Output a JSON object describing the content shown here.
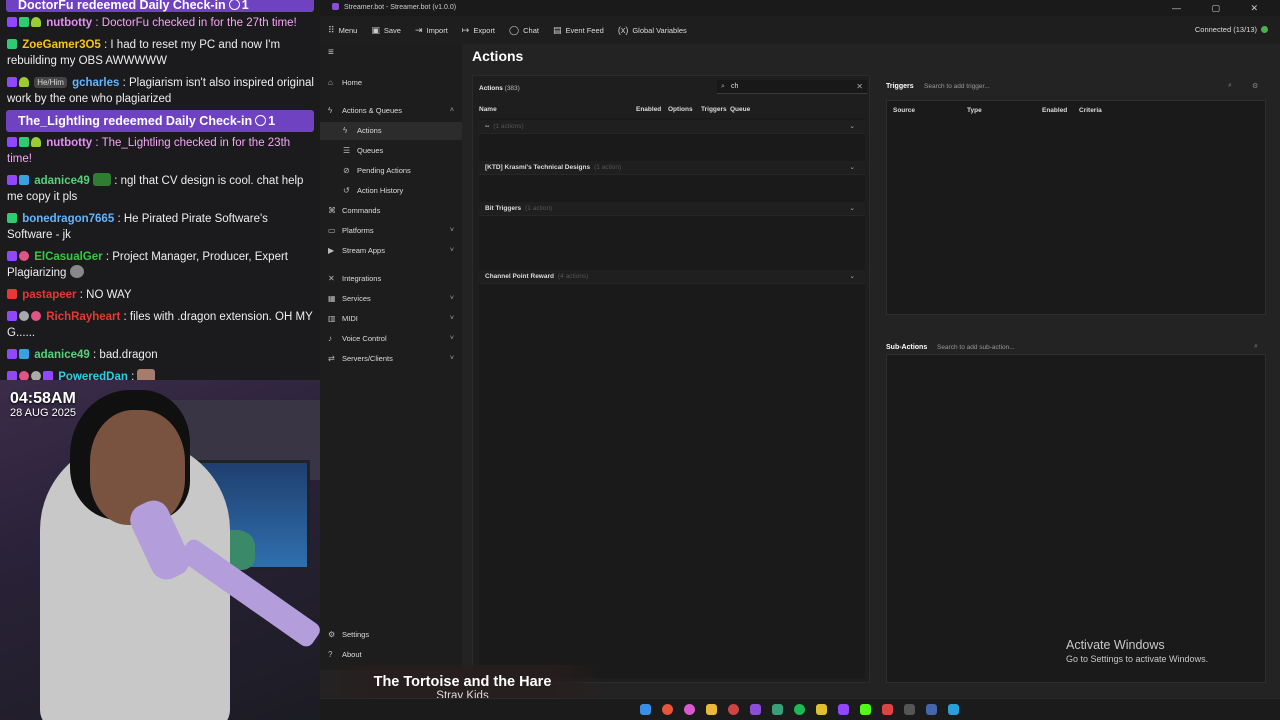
{
  "chat": {
    "redeems": [
      {
        "text": "DoctorFu redeemed Daily Check-in",
        "count": "1"
      },
      {
        "text": "The_Lightling redeemed Daily Check-in",
        "count": "1"
      }
    ],
    "messages": [
      {
        "user": "nutbotty",
        "color": "#e48df2",
        "text": ": DoctorFu checked in for the 27th time!",
        "text_color": "#f6a6f6"
      },
      {
        "user": "ZoeGamer3O5",
        "color": "#f5c518",
        "text": ": I had to reset my PC and now I'm rebuilding my OBS AWWWWW"
      },
      {
        "user": "gcharles",
        "pronoun": "He/Him",
        "color": "#62b6ff",
        "text": ": Plagiarism isn't also inspired original work by the one who plagiarized"
      },
      {
        "user": "nutbotty",
        "color": "#e48df2",
        "text": ": The_Lightling checked in for the 23th time!",
        "text_color": "#f6a6f6"
      },
      {
        "user": "adanice49",
        "color": "#5ad07a",
        "text": ": ngl that CV design is cool. chat help me copy it pls"
      },
      {
        "user": "bonedragon7665",
        "color": "#62b6ff",
        "text": ": He Pirated Pirate Software's Software - jk"
      },
      {
        "user": "ElCasualGer",
        "color": "#2ecc40",
        "text": ": Project Manager, Producer, Expert Plagiarizing"
      },
      {
        "user": "pastapeer",
        "color": "#e53935",
        "text": ": NO WAY"
      },
      {
        "user": "RichRayheart",
        "color": "#e53935",
        "text": ": files with .dragon extension. OH MY G......"
      },
      {
        "user": "adanice49",
        "color": "#5ad07a",
        "text": ": bad.dragon"
      },
      {
        "user": "PoweredDan",
        "color": "#2ecce0",
        "text": ":"
      }
    ]
  },
  "overlay": {
    "time": "04:58AM",
    "date": "28 AUG 2025",
    "song_title": "The Tortoise and the Hare",
    "song_artist": "Stray Kids"
  },
  "window": {
    "title": "Streamer.bot - Streamer.bot (v1.0.0)",
    "controls": "— ▢ ✕"
  },
  "toolbar": {
    "menu": "Menu",
    "save": "Save",
    "import": "Import",
    "export": "Export",
    "chat": "Chat",
    "event_feed": "Event Feed",
    "global_variables": "Global Variables",
    "connected": "Connected (13/13)"
  },
  "sidebar": {
    "items": [
      {
        "label": "Home",
        "icon": "home-icon"
      },
      {
        "label": "Actions & Queues",
        "icon": "bolt-icon",
        "chevron": "˄"
      },
      {
        "label": "Actions",
        "icon": "bolt-icon"
      },
      {
        "label": "Queues",
        "icon": "list-icon"
      },
      {
        "label": "Pending Actions",
        "icon": "pending-icon"
      },
      {
        "label": "Action History",
        "icon": "history-icon"
      },
      {
        "label": "Commands",
        "icon": "terminal-icon"
      },
      {
        "label": "Platforms",
        "icon": "platform-icon",
        "chevron": "˅"
      },
      {
        "label": "Stream Apps",
        "icon": "apps-icon",
        "chevron": "˅"
      },
      {
        "label": "Integrations",
        "icon": "integration-icon"
      },
      {
        "label": "Services",
        "icon": "grid-icon",
        "chevron": "˅"
      },
      {
        "label": "MIDI",
        "icon": "midi-icon",
        "chevron": "˅"
      },
      {
        "label": "Voice Control",
        "icon": "mic-icon",
        "chevron": "˅"
      },
      {
        "label": "Servers/Clients",
        "icon": "server-icon",
        "chevron": "˅"
      },
      {
        "label": "Settings",
        "icon": "gear-icon"
      },
      {
        "label": "About",
        "icon": "info-icon"
      }
    ]
  },
  "main": {
    "title": "Actions",
    "actions_label": "Actions",
    "actions_count": "(383)",
    "search_value": "ch",
    "columns": [
      "Name",
      "Enabled",
      "Options",
      "Triggers",
      "Queue"
    ],
    "groups": [
      {
        "name": "--",
        "count": "(1 actions)"
      },
      {
        "name": "[KTD] Krasmi's Technical Designs",
        "count": "(1 action)"
      },
      {
        "name": "Bit Triggers",
        "count": "(1 action)"
      },
      {
        "name": "Channel Point Reward",
        "count": "(4 actions)"
      }
    ]
  },
  "triggers": {
    "label": "Triggers",
    "placeholder": "Search to add trigger...",
    "columns": [
      "Source",
      "Type",
      "Enabled",
      "Criteria"
    ]
  },
  "subactions": {
    "label": "Sub-Actions",
    "placeholder": "Search to add sub-action..."
  },
  "watermark": {
    "line1": "Activate Windows",
    "line2": "Go to Settings to activate Windows."
  },
  "colors": {
    "accent": "#6f42c1",
    "connected": "#4caf50",
    "app_bg": "#232323"
  }
}
